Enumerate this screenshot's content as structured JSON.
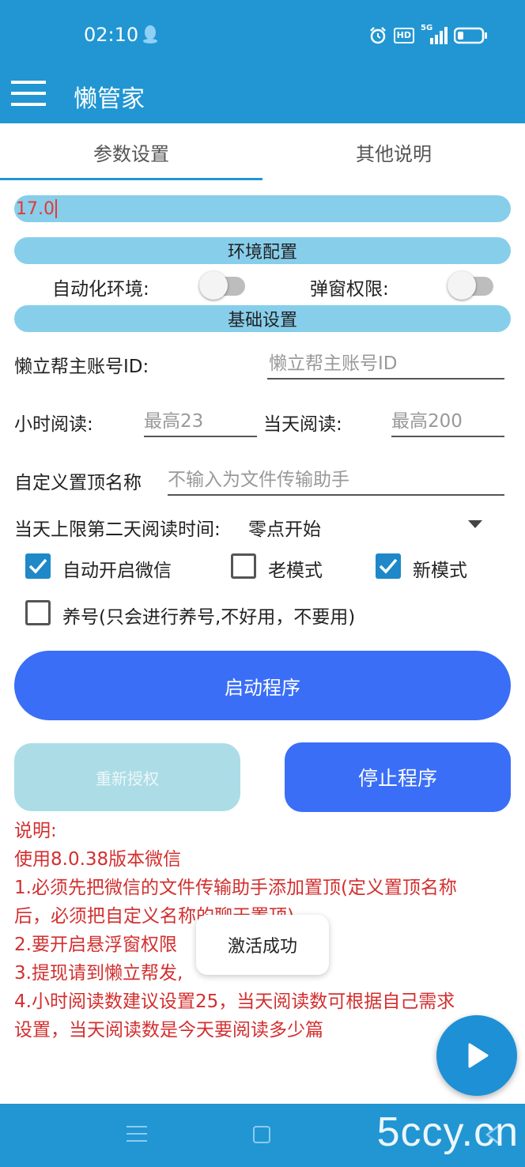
{
  "status_bar": {
    "time": "02:10",
    "icons": [
      "qq-icon",
      "alarm-icon",
      "hd-icon",
      "5g-signal-icon",
      "battery-icon"
    ],
    "hd_label": "HD",
    "network_label": "5G"
  },
  "app_bar": {
    "title": "懒管家",
    "menu_icon": "hamburger-menu-icon"
  },
  "tabs": [
    {
      "label": "参数设置",
      "selected": true
    },
    {
      "label": "其他说明",
      "selected": false
    }
  ],
  "version_field": {
    "value": "17.0"
  },
  "sections": {
    "env": "环境配置",
    "basic": "基础设置"
  },
  "env_config": {
    "auto_env_label": "自动化环境:",
    "auto_env_on": false,
    "popup_perm_label": "弹窗权限:",
    "popup_perm_on": false
  },
  "basic": {
    "account_label": "懒立帮主账号ID:",
    "account_placeholder": "懒立帮主账号ID",
    "hour_read_label": "小时阅读:",
    "hour_read_placeholder": "最高23",
    "day_read_label": "当天阅读:",
    "day_read_placeholder": "最高200",
    "pin_name_label": "自定义置顶名称",
    "pin_name_placeholder": "不输入为文件传输助手",
    "next_day_label": "当天上限第二天阅读时间:",
    "next_day_value": "零点开始"
  },
  "checkboxes": [
    {
      "label": "自动开启微信",
      "checked": true
    },
    {
      "label": "老模式",
      "checked": false
    },
    {
      "label": "新模式",
      "checked": true
    },
    {
      "label": "养号(只会进行养号,不好用，不要用)",
      "checked": false
    }
  ],
  "buttons": {
    "start": "启动程序",
    "reauth": "重新授权",
    "stop": "停止程序"
  },
  "notes": {
    "title": "说明:",
    "lines": [
      "使用8.0.38版本微信",
      "1.必须先把微信的文件传输助手添加置顶(定义置顶名称",
      "后，必须把自定义名称的聊天置顶)",
      "2.要开启悬浮窗权限",
      "3.提现请到懒立帮发,",
      "4.小时阅读数建议设置25，当天阅读数可根据自己需求",
      "设置，当天阅读数是今天要阅读多少篇"
    ]
  },
  "toast": {
    "text": "激活成功"
  },
  "watermark": "5ccy.cn",
  "colors": {
    "primary": "#2196d3",
    "pill": "#87ceeb",
    "button": "#3a6ef7",
    "button_disabled": "#acdde6",
    "note_text": "#d32f2f",
    "checkbox": "#1e88c8"
  }
}
